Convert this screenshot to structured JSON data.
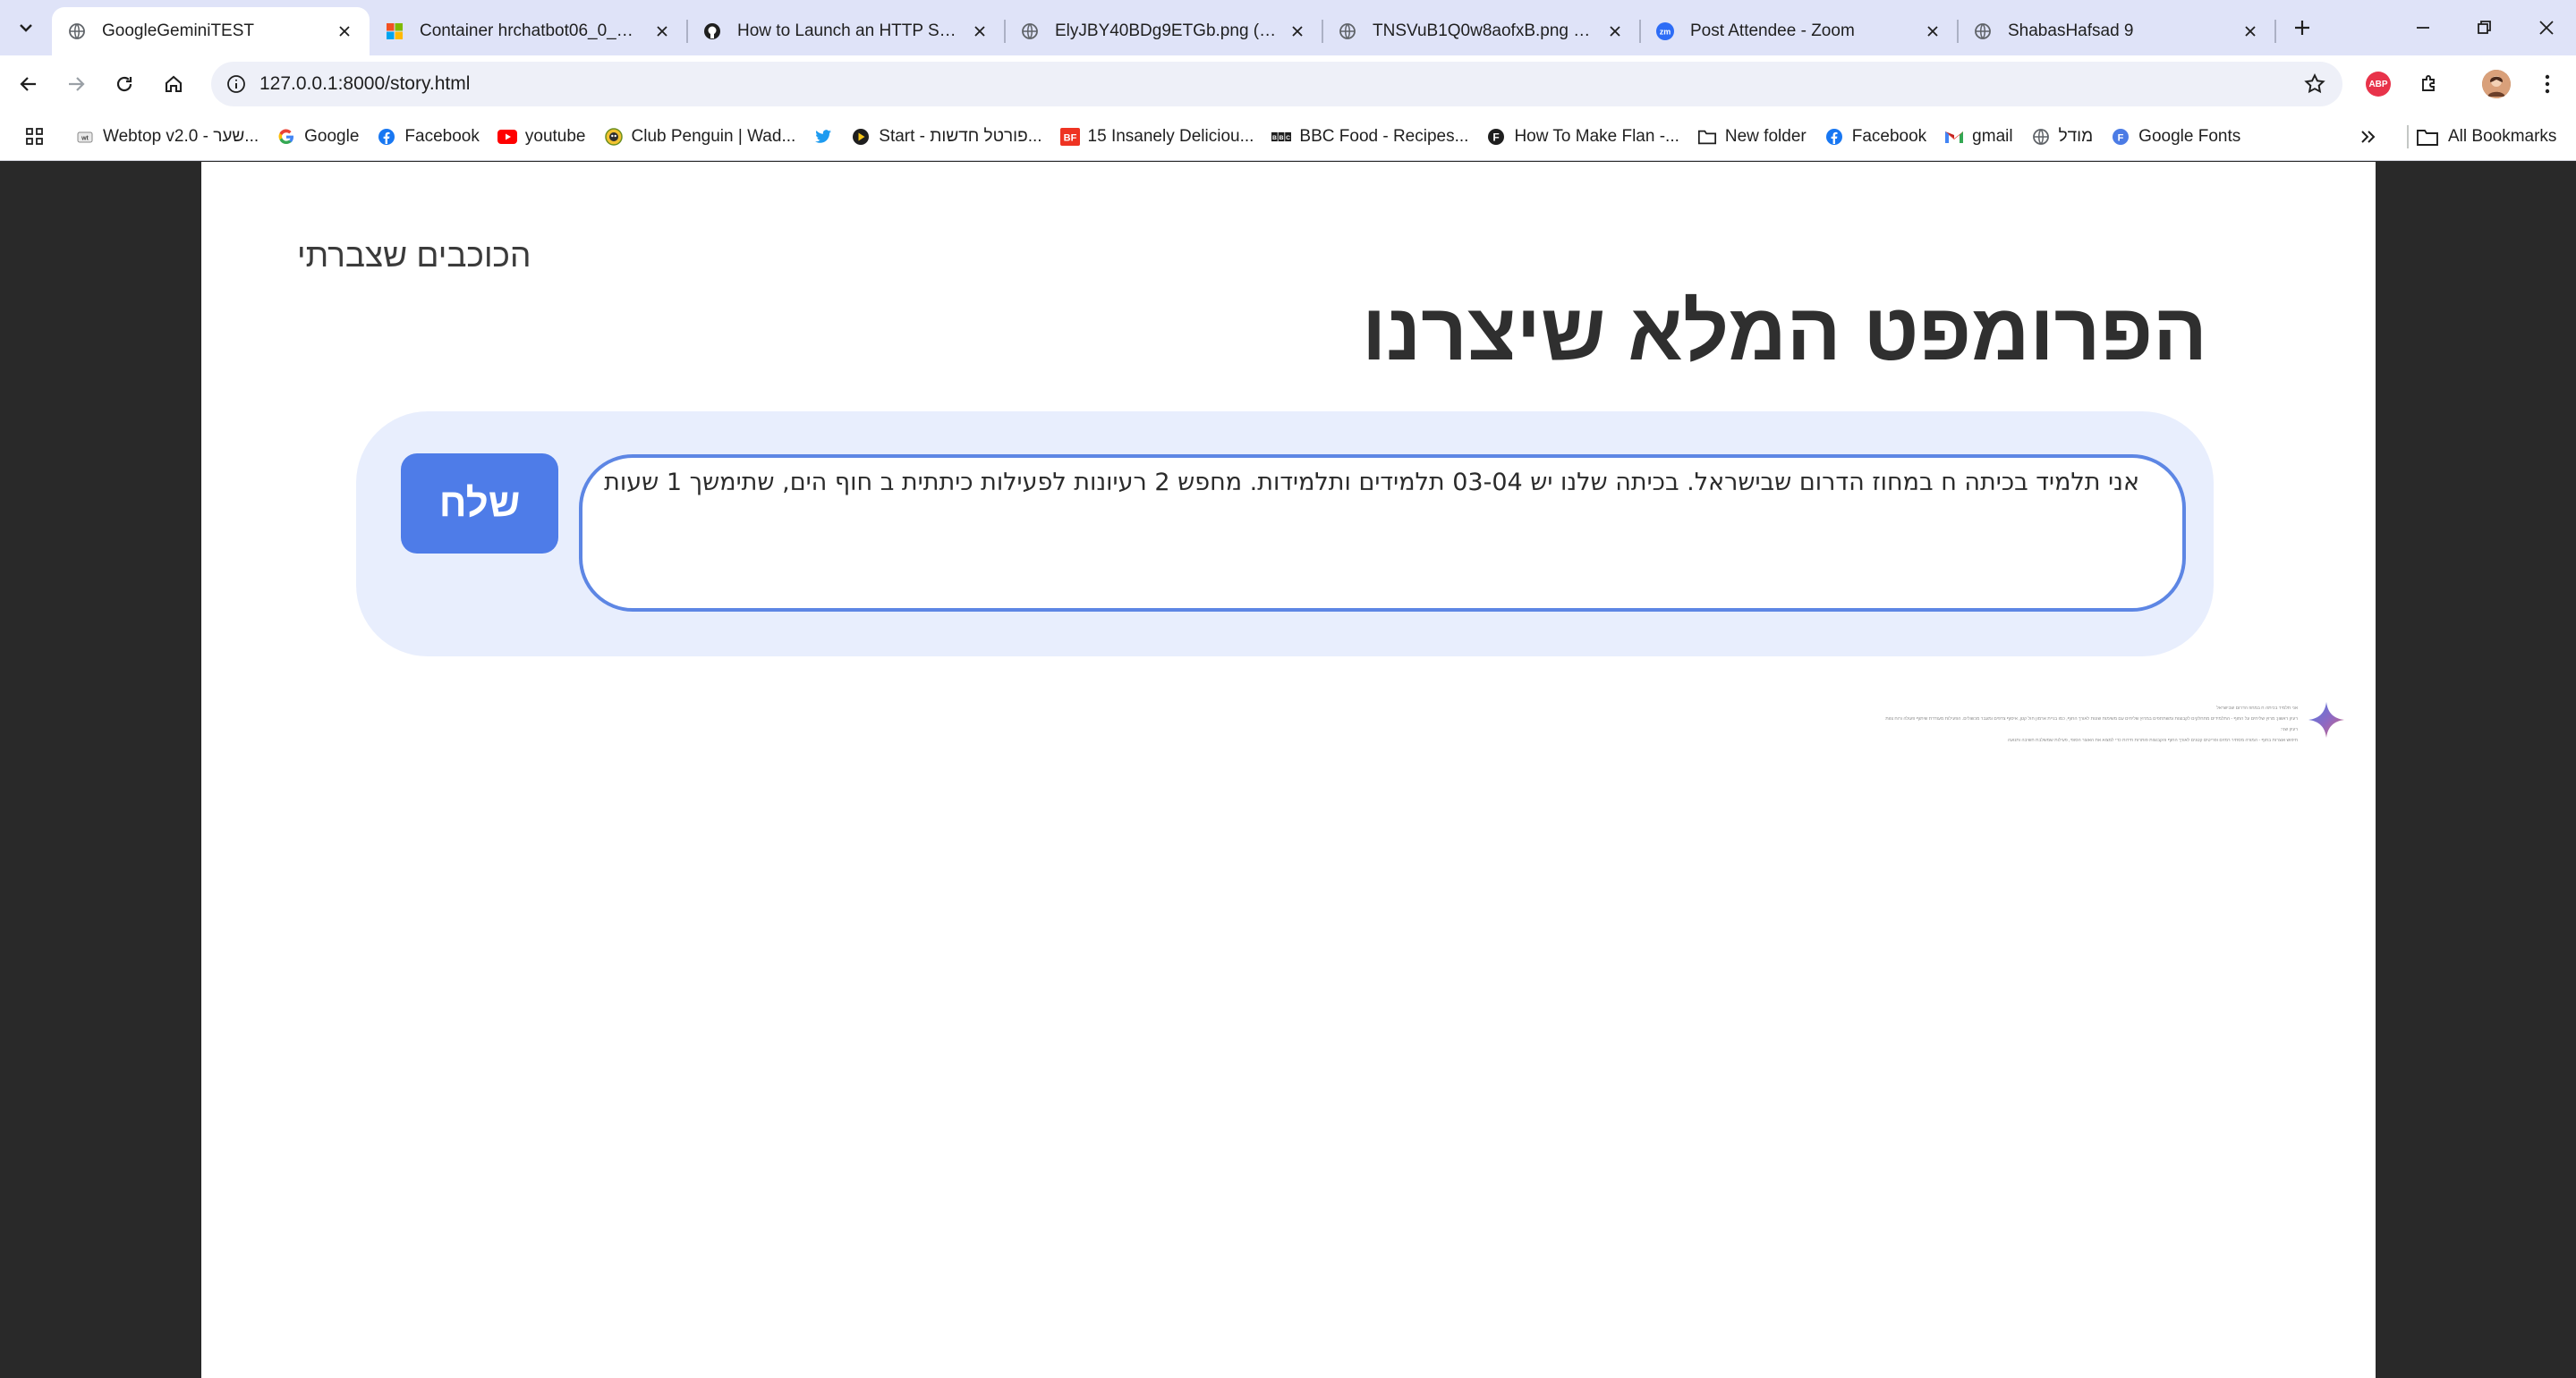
{
  "browser": {
    "tabs": [
      {
        "title": "GoogleGeminiTEST",
        "icon": "globe-icon",
        "active": true
      },
      {
        "title": "Container hrchatbot06_0_0324",
        "icon": "microsoft-icon",
        "active": false
      },
      {
        "title": "How to Launch an HTTP Server",
        "icon": "github-icon",
        "active": false
      },
      {
        "title": "ElyJBY40BDg9ETGb.png (1280×",
        "icon": "globe-icon",
        "active": false
      },
      {
        "title": "TNSVuB1Q0w8aofxB.png (1280",
        "icon": "globe-icon",
        "active": false
      },
      {
        "title": "Post Attendee - Zoom",
        "icon": "zoom-icon",
        "active": false
      },
      {
        "title": "ShabasHafsad 9",
        "icon": "globe-icon",
        "active": false
      }
    ],
    "url": "127.0.0.1:8000/story.html",
    "abp_label": "ABP",
    "bookmarks": [
      {
        "label": "Webtop v2.0 - שער...",
        "icon": "webtop-icon"
      },
      {
        "label": "Google",
        "icon": "google-icon"
      },
      {
        "label": "Facebook",
        "icon": "facebook-icon"
      },
      {
        "label": "youtube",
        "icon": "youtube-icon"
      },
      {
        "label": "Club Penguin | Wad...",
        "icon": "club-penguin-icon"
      },
      {
        "label": "",
        "icon": "twitter-icon"
      },
      {
        "label": "Start - פורטל חדשות...",
        "icon": "start-icon"
      },
      {
        "label": "15 Insanely Deliciou...",
        "icon": "buzzfeed-icon"
      },
      {
        "label": "BBC Food - Recipes...",
        "icon": "bbc-icon"
      },
      {
        "label": "How To Make Flan -...",
        "icon": "f-icon"
      },
      {
        "label": "New folder",
        "icon": "folder-icon"
      },
      {
        "label": "Facebook",
        "icon": "facebook-icon"
      },
      {
        "label": "gmail",
        "icon": "gmail-icon"
      },
      {
        "label": "מודל",
        "icon": "globe-icon"
      },
      {
        "label": "Google Fonts",
        "icon": "google-fonts-icon"
      }
    ],
    "all_bookmarks_label": "All Bookmarks",
    "colors": {
      "tabstrip": "#dfe3f8",
      "accent": "#4e7ce8"
    }
  },
  "page": {
    "stars_link": "הכוכבים שצברתי",
    "title": "הפרומפט המלא שיצרנו",
    "send_label": "שלח",
    "prompt_text": "אני תלמיד בכיתה ח במחוז הדרום שבישראל. בכיתה שלנו יש 03-04 תלמידים ותלמידות. מחפש 2 רעיונות לפעילות כיתתית ב חוף הים, שתימשך 1 שעות",
    "response_lines": [
      "אני תלמיד בכיתה ח במחוז הדרום שבישראל",
      "רעיון ראשון: מרוץ שליחים על החוף - התלמידים מתחלקים לקבוצות ומשתתפים במרוץ שליחים עם משימות שונות לאורך החוף, כמו בניית ארמון חול קטן, איסוף צדפים ומעבר מכשולים. הפעילות מעודדת שיתוף פעולה ורוח צוות",
      "רעיון שני:",
      "חיפוש אוצרות בחוף - המורה מסתיר רמזים ופריטים קטנים לאורך החוף והקבוצות פותרות חידות כדי למצוא את האוצר הסופי, פעילות שמשלבת חשיבה ותנועה"
    ]
  }
}
